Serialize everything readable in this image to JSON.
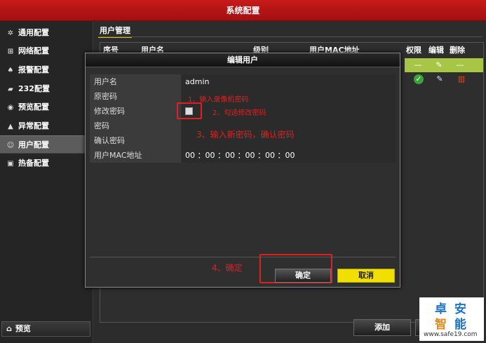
{
  "window": {
    "title": "系统配置"
  },
  "sidebar": {
    "items": [
      {
        "label": "通用配置",
        "icon": "gear-icon"
      },
      {
        "label": "网络配置",
        "icon": "network-icon"
      },
      {
        "label": "报警配置",
        "icon": "alarm-icon"
      },
      {
        "label": "232配置",
        "icon": "serial-icon"
      },
      {
        "label": "预览配置",
        "icon": "eye-icon"
      },
      {
        "label": "异常配置",
        "icon": "warning-icon"
      },
      {
        "label": "用户配置",
        "icon": "users-icon",
        "active": true
      },
      {
        "label": "热备配置",
        "icon": "backup-icon"
      }
    ],
    "preview_label": "预览"
  },
  "main": {
    "section_title": "用户管理",
    "table": {
      "headers": [
        "序号",
        "用户名",
        "级别",
        "用户MAC地址",
        "权限",
        "编辑",
        "删除"
      ]
    },
    "add_label": "添加"
  },
  "modal": {
    "title": "编辑用户",
    "fields": [
      {
        "label": "用户名",
        "value": "admin"
      },
      {
        "label": "原密码",
        "value": ""
      },
      {
        "label": "修改密码",
        "value": ""
      },
      {
        "label": "密码",
        "value": ""
      },
      {
        "label": "确认密码",
        "value": ""
      },
      {
        "label": "用户MAC地址",
        "value": "00 ：00 ：00 ：00 ：00 ：00"
      }
    ],
    "ok_label": "确定",
    "cancel_label": "取消"
  },
  "annotations": {
    "step1": "1、输入录像机密码",
    "step2": "2、勾选修改密码",
    "step3": "3、输入新密码，确认密码",
    "step4": "4、确定"
  },
  "watermark": {
    "line1a": "卓",
    "line1b": "安",
    "line2a": "智",
    "line2b": "能",
    "url": "www.safe19.com"
  },
  "colors": {
    "titlebar": "#b81515",
    "accent_yellow": "#f0df00",
    "selected_row": "#a7c645",
    "annotation_red": "#e02020"
  }
}
